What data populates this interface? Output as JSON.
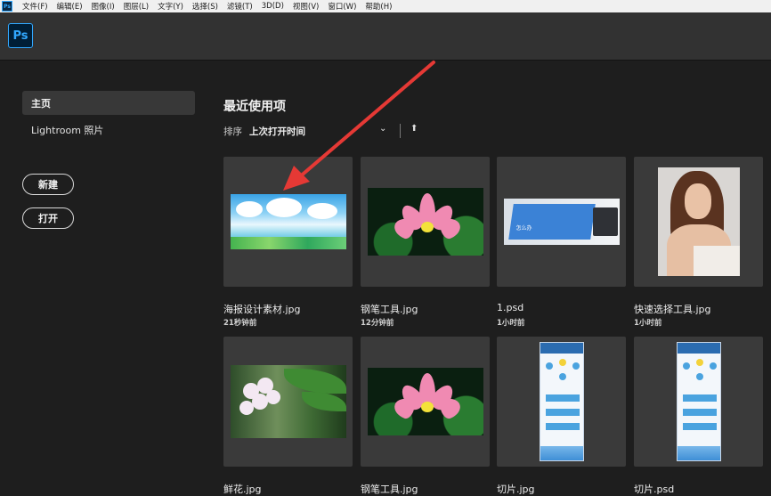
{
  "menubar": {
    "items": [
      "文件(F)",
      "编辑(E)",
      "图像(I)",
      "图层(L)",
      "文字(Y)",
      "选择(S)",
      "滤镜(T)",
      "3D(D)",
      "视图(V)",
      "窗口(W)",
      "帮助(H)"
    ]
  },
  "app": {
    "logo": "Ps",
    "accent": "#31a8ff"
  },
  "sidebar": {
    "home_label": "主页",
    "lightroom_label": "Lightroom 照片",
    "new_button": "新建",
    "open_button": "打开"
  },
  "recent": {
    "title": "最近使用项",
    "sort_label": "排序",
    "sort_value": "上次打开时间",
    "chevron_icon": "chevron-down-icon",
    "sort_direction_icon": "arrow-up-icon",
    "files": [
      {
        "name": "海报设计素材.jpg",
        "time": "21秒钟前"
      },
      {
        "name": "钢笔工具.jpg",
        "time": "12分钟前"
      },
      {
        "name": "1.psd",
        "time": "1小时前"
      },
      {
        "name": "快速选择工具.jpg",
        "time": "1小时前"
      },
      {
        "name": "鲜花.jpg",
        "time": ""
      },
      {
        "name": "钢笔工具.jpg",
        "time": ""
      },
      {
        "name": "切片.jpg",
        "time": ""
      },
      {
        "name": "切片.psd",
        "time": ""
      }
    ],
    "office_thumb_text": "怎么办"
  },
  "annotation": {
    "arrow_color": "#e53935"
  }
}
